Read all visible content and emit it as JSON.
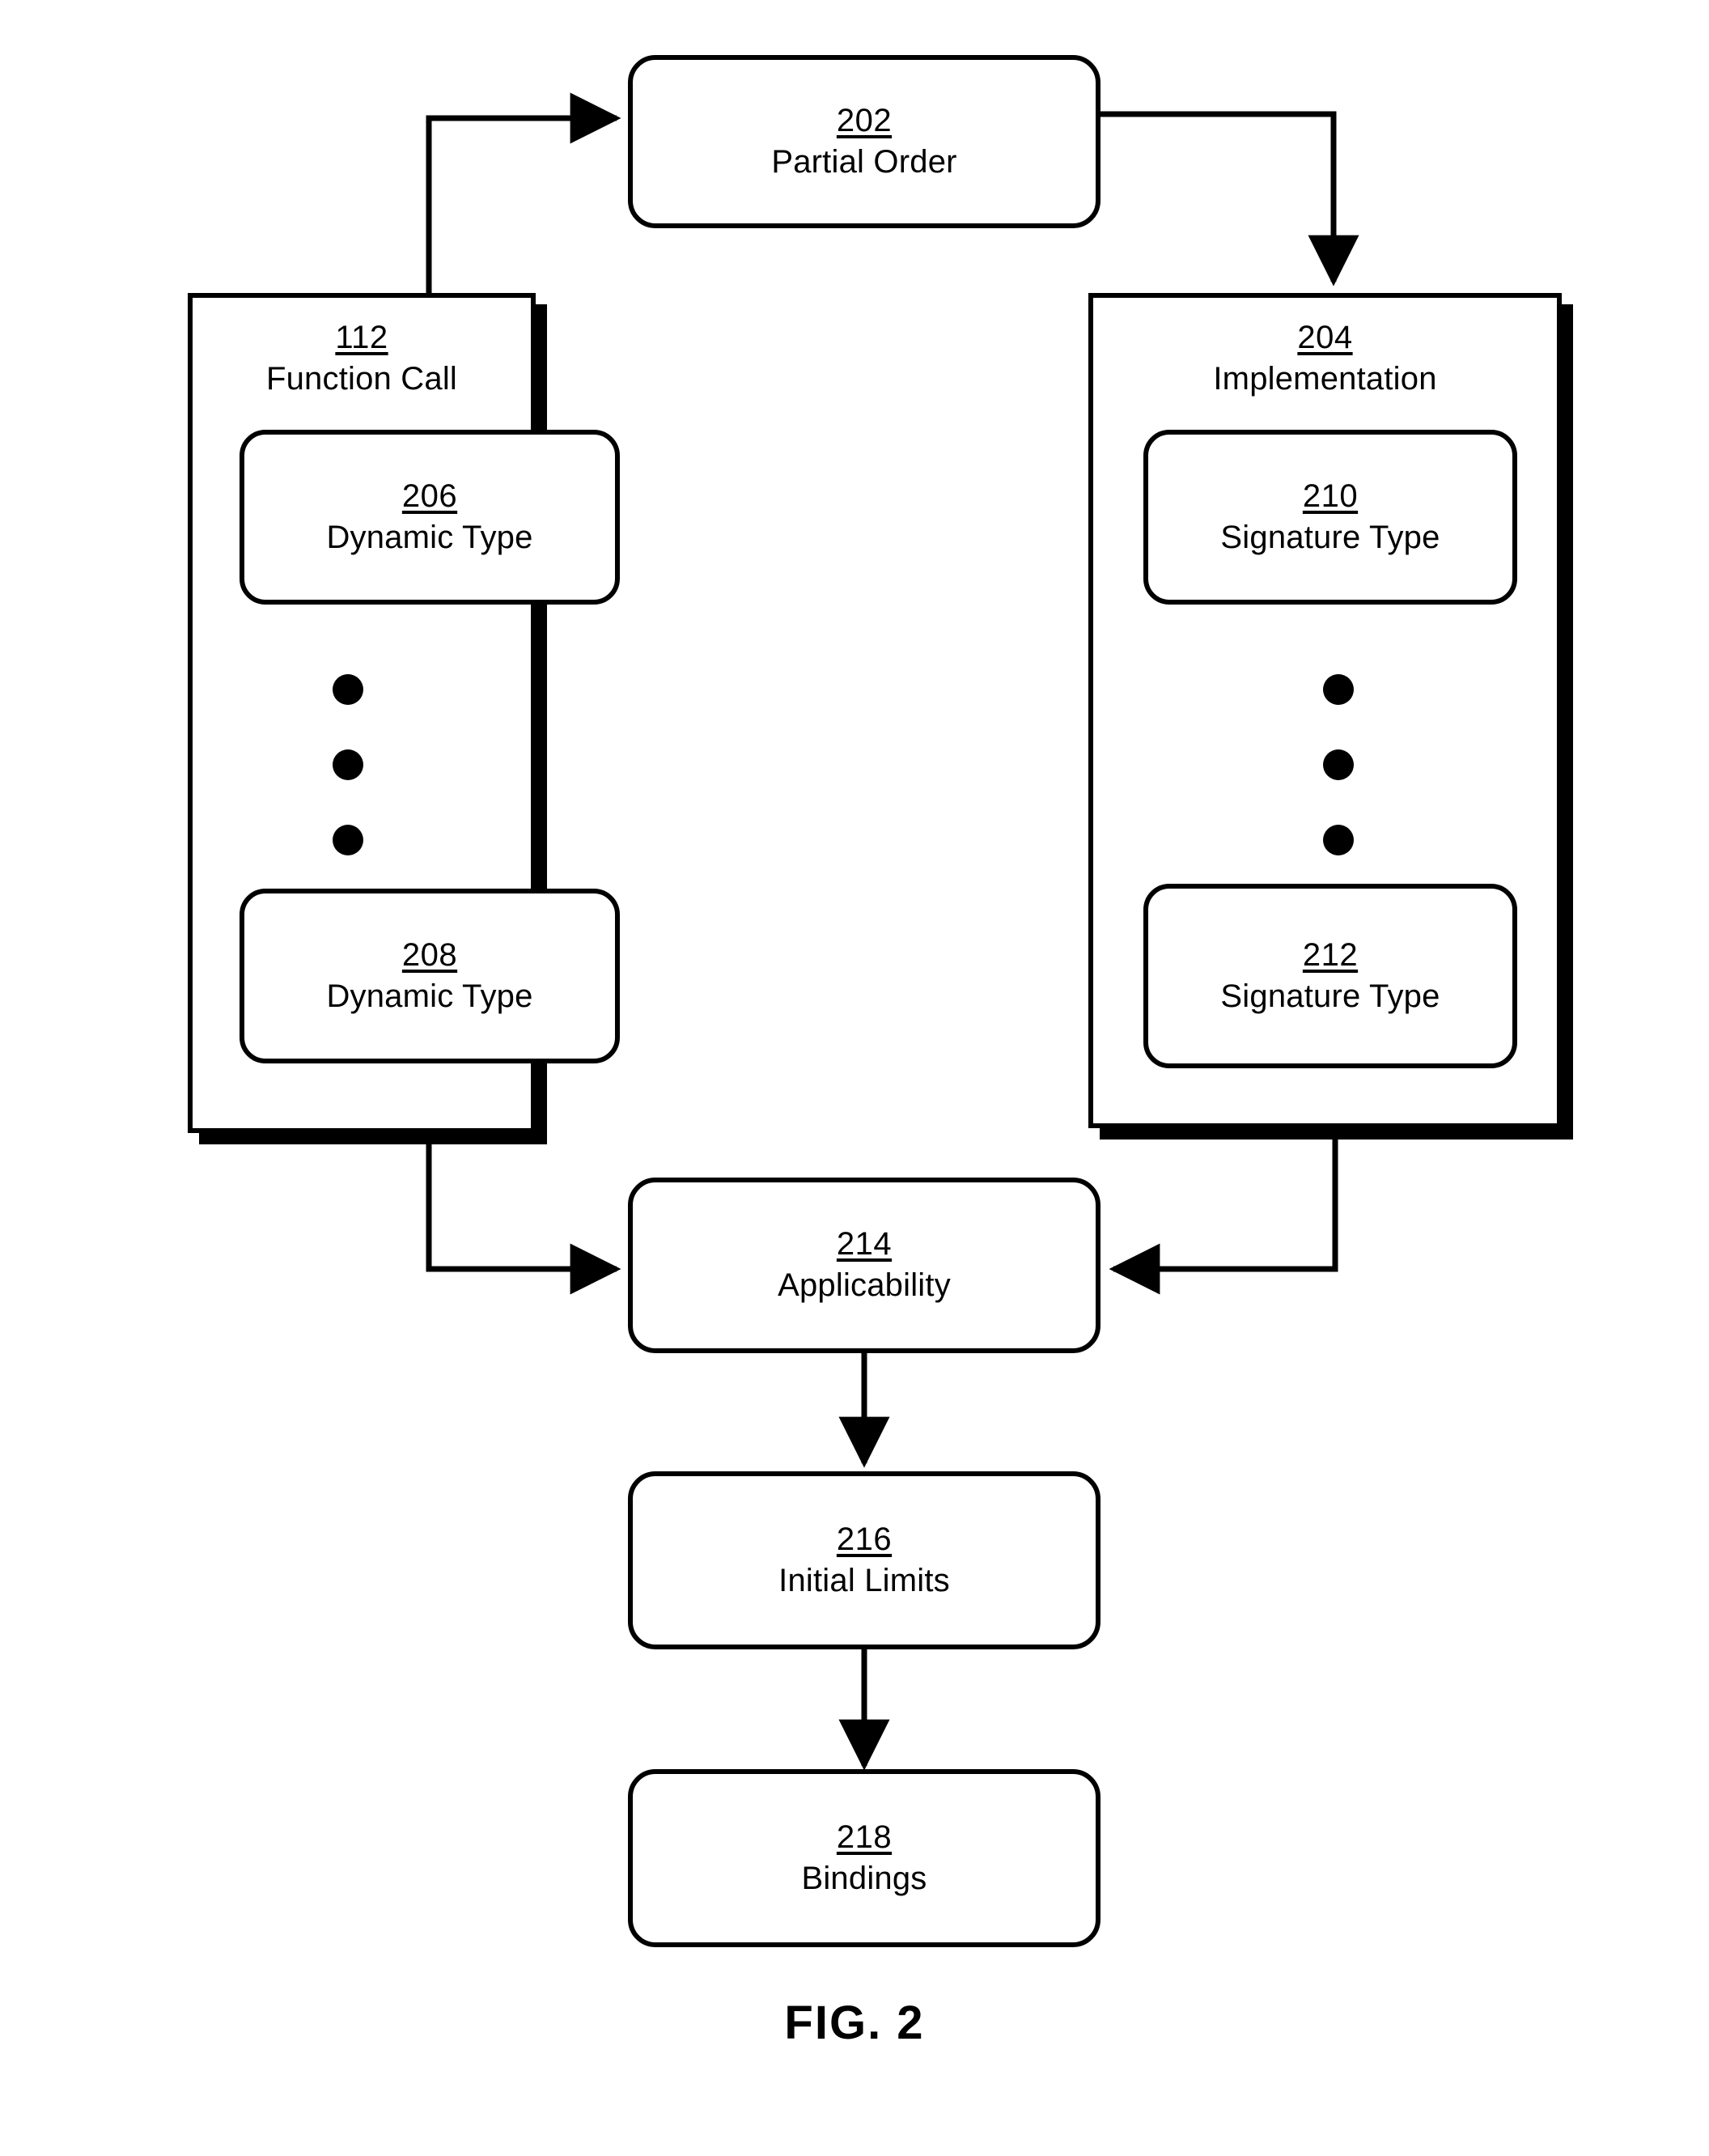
{
  "figure": {
    "caption": "FIG. 2"
  },
  "nodes": {
    "partial_order": {
      "ref": "202",
      "label": "Partial Order"
    },
    "function_call": {
      "ref": "112",
      "label": "Function Call"
    },
    "implementation": {
      "ref": "204",
      "label": "Implementation"
    },
    "dynamic_type_first": {
      "ref": "206",
      "label": "Dynamic Type"
    },
    "dynamic_type_last": {
      "ref": "208",
      "label": "Dynamic Type"
    },
    "signature_type_first": {
      "ref": "210",
      "label": "Signature Type"
    },
    "signature_type_last": {
      "ref": "212",
      "label": "Signature Type"
    },
    "applicability": {
      "ref": "214",
      "label": "Applicability"
    },
    "initial_limits": {
      "ref": "216",
      "label": "Initial Limits"
    },
    "bindings": {
      "ref": "218",
      "label": "Bindings"
    }
  },
  "ellipsis": {
    "dot_count": 3,
    "meaning": "vertical-ellipsis"
  },
  "colors": {
    "stroke": "#000000",
    "fill": "#ffffff"
  }
}
